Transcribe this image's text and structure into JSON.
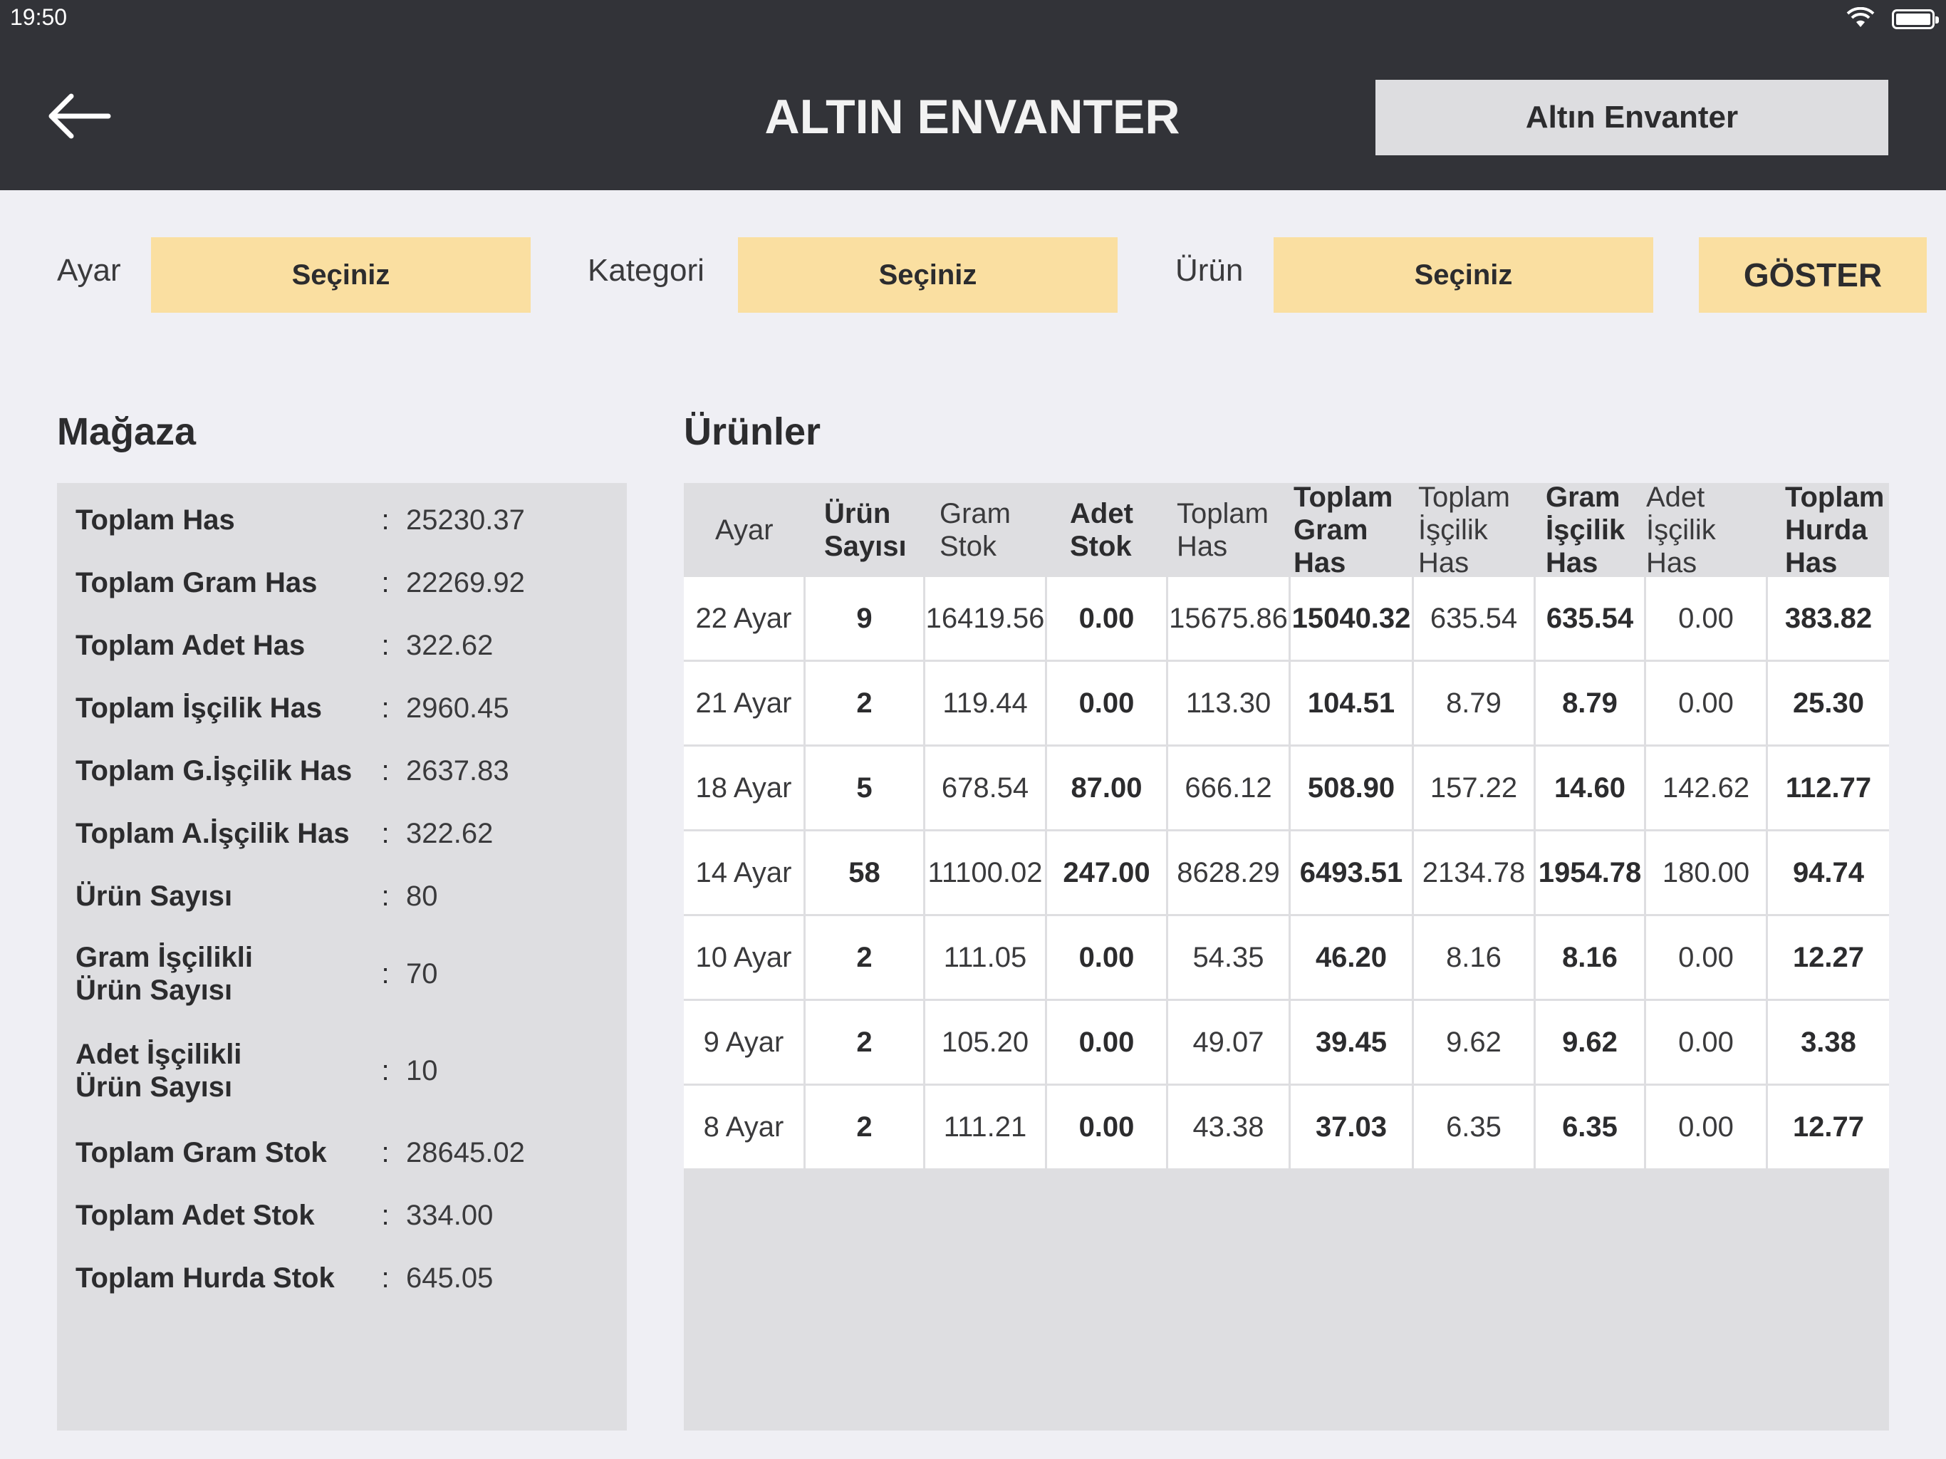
{
  "status": {
    "time": "19:50"
  },
  "header": {
    "back_icon": "arrow-left-icon",
    "title": "ALTIN ENVANTER",
    "button_label": "Altın Envanter"
  },
  "filters": {
    "ayar_label": "Ayar",
    "ayar_value": "Seçiniz",
    "kategori_label": "Kategori",
    "kategori_value": "Seçiniz",
    "urun_label": "Ürün",
    "urun_value": "Seçiniz",
    "show_button": "GÖSTER"
  },
  "store": {
    "title": "Mağaza",
    "colon": ":",
    "rows": [
      {
        "label": "Toplam Has",
        "value": "25230.37"
      },
      {
        "label": "Toplam Gram Has",
        "value": "22269.92"
      },
      {
        "label": "Toplam Adet Has",
        "value": "322.62"
      },
      {
        "label": "Toplam İşçilik Has",
        "value": "2960.45"
      },
      {
        "label": "Toplam G.İşçilik Has",
        "value": "2637.83"
      },
      {
        "label": "Toplam A.İşçilik Has",
        "value": "322.62"
      },
      {
        "label": "Ürün Sayısı",
        "value": "80"
      },
      {
        "label": "Gram İşçilikli\nÜrün Sayısı",
        "value": "70"
      },
      {
        "label": "Adet İşçilikli\nÜrün Sayısı",
        "value": "10"
      },
      {
        "label": "Toplam Gram Stok",
        "value": "28645.02"
      },
      {
        "label": "Toplam Adet Stok",
        "value": "334.00"
      },
      {
        "label": "Toplam Hurda Stok",
        "value": "645.05"
      }
    ]
  },
  "products": {
    "title": "Ürünler",
    "columns": [
      {
        "label": "Ayar",
        "bold": false
      },
      {
        "label": "Ürün\nSayısı",
        "bold": true
      },
      {
        "label": "Gram\nStok",
        "bold": false
      },
      {
        "label": "Adet\nStok",
        "bold": true
      },
      {
        "label": "Toplam\nHas",
        "bold": false
      },
      {
        "label": "Toplam\nGram\nHas",
        "bold": true
      },
      {
        "label": "Toplam\nİşçilik\nHas",
        "bold": false
      },
      {
        "label": "Gram\nİşçilik\nHas",
        "bold": true
      },
      {
        "label": "Adet\nİşçilik\nHas",
        "bold": false
      },
      {
        "label": "Toplam\nHurda\nHas",
        "bold": true
      }
    ],
    "rows": [
      [
        "22 Ayar",
        "9",
        "16419.56",
        "0.00",
        "15675.86",
        "15040.32",
        "635.54",
        "635.54",
        "0.00",
        "383.82"
      ],
      [
        "21 Ayar",
        "2",
        "119.44",
        "0.00",
        "113.30",
        "104.51",
        "8.79",
        "8.79",
        "0.00",
        "25.30"
      ],
      [
        "18 Ayar",
        "5",
        "678.54",
        "87.00",
        "666.12",
        "508.90",
        "157.22",
        "14.60",
        "142.62",
        "112.77"
      ],
      [
        "14 Ayar",
        "58",
        "11100.02",
        "247.00",
        "8628.29",
        "6493.51",
        "2134.78",
        "1954.78",
        "180.00",
        "94.74"
      ],
      [
        "10 Ayar",
        "2",
        "111.05",
        "0.00",
        "54.35",
        "46.20",
        "8.16",
        "8.16",
        "0.00",
        "12.27"
      ],
      [
        "9 Ayar",
        "2",
        "105.20",
        "0.00",
        "49.07",
        "39.45",
        "9.62",
        "9.62",
        "0.00",
        "3.38"
      ],
      [
        "8 Ayar",
        "2",
        "111.21",
        "0.00",
        "43.38",
        "37.03",
        "6.35",
        "6.35",
        "0.00",
        "12.77"
      ]
    ]
  },
  "colors": {
    "header_bg": "#323338",
    "accent_yellow": "#fadfa1",
    "panel_gray": "#dedee1",
    "page_bg": "#efeff4"
  }
}
